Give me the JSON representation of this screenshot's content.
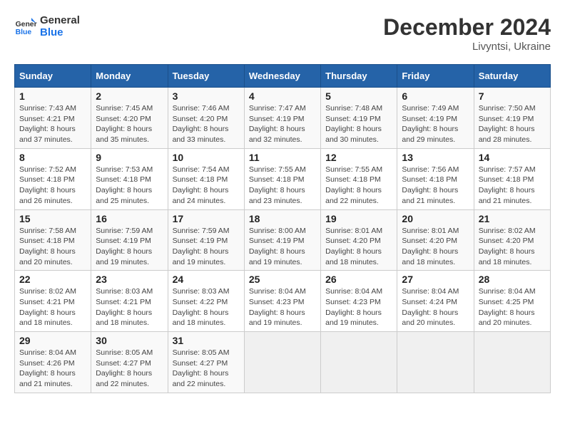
{
  "logo": {
    "line1": "General",
    "line2": "Blue"
  },
  "title": "December 2024",
  "subtitle": "Livyntsi, Ukraine",
  "days_header": [
    "Sunday",
    "Monday",
    "Tuesday",
    "Wednesday",
    "Thursday",
    "Friday",
    "Saturday"
  ],
  "weeks": [
    [
      {
        "day": "1",
        "info": "Sunrise: 7:43 AM\nSunset: 4:21 PM\nDaylight: 8 hours\nand 37 minutes."
      },
      {
        "day": "2",
        "info": "Sunrise: 7:45 AM\nSunset: 4:20 PM\nDaylight: 8 hours\nand 35 minutes."
      },
      {
        "day": "3",
        "info": "Sunrise: 7:46 AM\nSunset: 4:20 PM\nDaylight: 8 hours\nand 33 minutes."
      },
      {
        "day": "4",
        "info": "Sunrise: 7:47 AM\nSunset: 4:19 PM\nDaylight: 8 hours\nand 32 minutes."
      },
      {
        "day": "5",
        "info": "Sunrise: 7:48 AM\nSunset: 4:19 PM\nDaylight: 8 hours\nand 30 minutes."
      },
      {
        "day": "6",
        "info": "Sunrise: 7:49 AM\nSunset: 4:19 PM\nDaylight: 8 hours\nand 29 minutes."
      },
      {
        "day": "7",
        "info": "Sunrise: 7:50 AM\nSunset: 4:19 PM\nDaylight: 8 hours\nand 28 minutes."
      }
    ],
    [
      {
        "day": "8",
        "info": "Sunrise: 7:52 AM\nSunset: 4:18 PM\nDaylight: 8 hours\nand 26 minutes."
      },
      {
        "day": "9",
        "info": "Sunrise: 7:53 AM\nSunset: 4:18 PM\nDaylight: 8 hours\nand 25 minutes."
      },
      {
        "day": "10",
        "info": "Sunrise: 7:54 AM\nSunset: 4:18 PM\nDaylight: 8 hours\nand 24 minutes."
      },
      {
        "day": "11",
        "info": "Sunrise: 7:55 AM\nSunset: 4:18 PM\nDaylight: 8 hours\nand 23 minutes."
      },
      {
        "day": "12",
        "info": "Sunrise: 7:55 AM\nSunset: 4:18 PM\nDaylight: 8 hours\nand 22 minutes."
      },
      {
        "day": "13",
        "info": "Sunrise: 7:56 AM\nSunset: 4:18 PM\nDaylight: 8 hours\nand 21 minutes."
      },
      {
        "day": "14",
        "info": "Sunrise: 7:57 AM\nSunset: 4:18 PM\nDaylight: 8 hours\nand 21 minutes."
      }
    ],
    [
      {
        "day": "15",
        "info": "Sunrise: 7:58 AM\nSunset: 4:18 PM\nDaylight: 8 hours\nand 20 minutes."
      },
      {
        "day": "16",
        "info": "Sunrise: 7:59 AM\nSunset: 4:19 PM\nDaylight: 8 hours\nand 19 minutes."
      },
      {
        "day": "17",
        "info": "Sunrise: 7:59 AM\nSunset: 4:19 PM\nDaylight: 8 hours\nand 19 minutes."
      },
      {
        "day": "18",
        "info": "Sunrise: 8:00 AM\nSunset: 4:19 PM\nDaylight: 8 hours\nand 19 minutes."
      },
      {
        "day": "19",
        "info": "Sunrise: 8:01 AM\nSunset: 4:20 PM\nDaylight: 8 hours\nand 18 minutes."
      },
      {
        "day": "20",
        "info": "Sunrise: 8:01 AM\nSunset: 4:20 PM\nDaylight: 8 hours\nand 18 minutes."
      },
      {
        "day": "21",
        "info": "Sunrise: 8:02 AM\nSunset: 4:20 PM\nDaylight: 8 hours\nand 18 minutes."
      }
    ],
    [
      {
        "day": "22",
        "info": "Sunrise: 8:02 AM\nSunset: 4:21 PM\nDaylight: 8 hours\nand 18 minutes."
      },
      {
        "day": "23",
        "info": "Sunrise: 8:03 AM\nSunset: 4:21 PM\nDaylight: 8 hours\nand 18 minutes."
      },
      {
        "day": "24",
        "info": "Sunrise: 8:03 AM\nSunset: 4:22 PM\nDaylight: 8 hours\nand 18 minutes."
      },
      {
        "day": "25",
        "info": "Sunrise: 8:04 AM\nSunset: 4:23 PM\nDaylight: 8 hours\nand 19 minutes."
      },
      {
        "day": "26",
        "info": "Sunrise: 8:04 AM\nSunset: 4:23 PM\nDaylight: 8 hours\nand 19 minutes."
      },
      {
        "day": "27",
        "info": "Sunrise: 8:04 AM\nSunset: 4:24 PM\nDaylight: 8 hours\nand 20 minutes."
      },
      {
        "day": "28",
        "info": "Sunrise: 8:04 AM\nSunset: 4:25 PM\nDaylight: 8 hours\nand 20 minutes."
      }
    ],
    [
      {
        "day": "29",
        "info": "Sunrise: 8:04 AM\nSunset: 4:26 PM\nDaylight: 8 hours\nand 21 minutes."
      },
      {
        "day": "30",
        "info": "Sunrise: 8:05 AM\nSunset: 4:27 PM\nDaylight: 8 hours\nand 22 minutes."
      },
      {
        "day": "31",
        "info": "Sunrise: 8:05 AM\nSunset: 4:27 PM\nDaylight: 8 hours\nand 22 minutes."
      },
      null,
      null,
      null,
      null
    ]
  ]
}
